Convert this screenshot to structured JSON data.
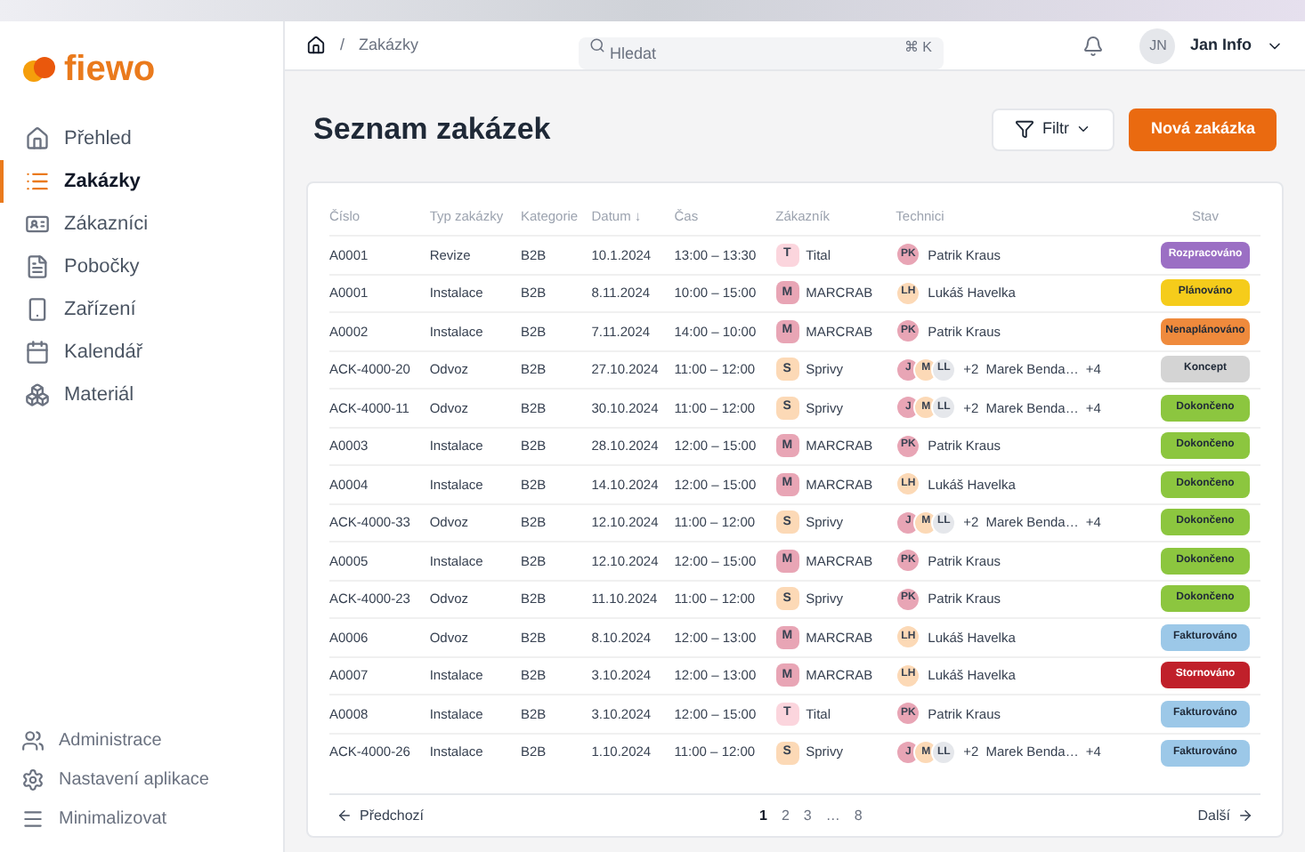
{
  "logo": "fiewo",
  "sidebar": {
    "items": [
      {
        "label": "Přehled",
        "selected": false
      },
      {
        "label": "Zakázky",
        "selected": true
      },
      {
        "label": "Zákazníci",
        "selected": false
      },
      {
        "label": "Pobočky",
        "selected": false
      },
      {
        "label": "Zařízení",
        "selected": false
      },
      {
        "label": "Kalendář",
        "selected": false
      },
      {
        "label": "Materiál",
        "selected": false
      }
    ],
    "bottom_items": [
      {
        "label": "Administrace"
      },
      {
        "label": "Nastavení aplikace"
      },
      {
        "label": "Minimalizovat"
      }
    ]
  },
  "topbar": {
    "breadcrumb_separator": "/",
    "breadcrumb": "Zakázky",
    "search": {
      "placeholder": "Hledat",
      "shortcut": "⌘ K"
    },
    "user": {
      "initials": "JN",
      "name": "Jan Info"
    }
  },
  "page": {
    "title": "Seznam zakázek",
    "filter_button": "Filtr",
    "new_button": "Nová zakázka"
  },
  "table": {
    "columns": [
      "Číslo",
      "Typ zakázky",
      "Kategorie",
      "Datum ↓",
      "Čas",
      "Zákazník",
      "Technici",
      "Stav"
    ],
    "rows": [
      {
        "number": "A0001",
        "type": "Revize",
        "category": "B2B",
        "date": "10.1.2024",
        "time": "13:00 – 13:30",
        "customer": {
          "initial": "T",
          "name": "Tital",
          "color": "#fbd5dd"
        },
        "technicians": {
          "avatars": [
            {
              "initials": "PK",
              "color": "#e8a5b5"
            }
          ],
          "name": "Patrik Kraus"
        },
        "status": {
          "label": "Rozpracováno",
          "color": "#9b6fc4"
        }
      },
      {
        "number": "A0001",
        "type": "Instalace",
        "category": "B2B",
        "date": "8.11.2024",
        "time": "10:00 – 15:00",
        "customer": {
          "initial": "M",
          "name": "MARCRAB",
          "color": "#e8a5b5"
        },
        "technicians": {
          "avatars": [
            {
              "initials": "LH",
              "color": "#fcd9b6"
            }
          ],
          "name": "Lukáš Havelka"
        },
        "status": {
          "label": "Plánováno",
          "color": "#f5cc1b"
        }
      },
      {
        "number": "A0002",
        "type": "Instalace",
        "category": "B2B",
        "date": "7.11.2024",
        "time": "14:00 – 10:00",
        "customer": {
          "initial": "M",
          "name": "MARCRAB",
          "color": "#e8a5b5"
        },
        "technicians": {
          "avatars": [
            {
              "initials": "PK",
              "color": "#e8a5b5"
            }
          ],
          "name": "Patrik Kraus"
        },
        "status": {
          "label": "Nenaplánováno",
          "color": "#ef8a3c"
        }
      },
      {
        "number": "ACK-4000-20",
        "type": "Odvoz",
        "category": "B2B",
        "date": "27.10.2024",
        "time": "11:00 – 12:00",
        "customer": {
          "initial": "S",
          "name": "Sprivy",
          "color": "#fcd9b6"
        },
        "technicians": {
          "avatars": [
            {
              "initials": "J",
              "color": "#e8a5b5"
            },
            {
              "initials": "M",
              "color": "#fcd9b6"
            },
            {
              "initials": "LL",
              "color": "#e5e7eb"
            }
          ],
          "extra": "+2",
          "name": "Marek Benda…",
          "more": "+4"
        },
        "status": {
          "label": "Koncept",
          "color": "#d4d4d4"
        }
      },
      {
        "number": "ACK-4000-11",
        "type": "Odvoz",
        "category": "B2B",
        "date": "30.10.2024",
        "time": "11:00 – 12:00",
        "customer": {
          "initial": "S",
          "name": "Sprivy",
          "color": "#fcd9b6"
        },
        "technicians": {
          "avatars": [
            {
              "initials": "J",
              "color": "#e8a5b5"
            },
            {
              "initials": "M",
              "color": "#fcd9b6"
            },
            {
              "initials": "LL",
              "color": "#e5e7eb"
            }
          ],
          "extra": "+2",
          "name": "Marek Benda…",
          "more": "+4"
        },
        "status": {
          "label": "Dokončeno",
          "color": "#8cc63f"
        }
      },
      {
        "number": "A0003",
        "type": "Instalace",
        "category": "B2B",
        "date": "28.10.2024",
        "time": "12:00 – 15:00",
        "customer": {
          "initial": "M",
          "name": "MARCRAB",
          "color": "#e8a5b5"
        },
        "technicians": {
          "avatars": [
            {
              "initials": "PK",
              "color": "#e8a5b5"
            }
          ],
          "name": "Patrik Kraus"
        },
        "status": {
          "label": "Dokončeno",
          "color": "#8cc63f"
        }
      },
      {
        "number": "A0004",
        "type": "Instalace",
        "category": "B2B",
        "date": "14.10.2024",
        "time": "12:00 – 15:00",
        "customer": {
          "initial": "M",
          "name": "MARCRAB",
          "color": "#e8a5b5"
        },
        "technicians": {
          "avatars": [
            {
              "initials": "LH",
              "color": "#fcd9b6"
            }
          ],
          "name": "Lukáš Havelka"
        },
        "status": {
          "label": "Dokončeno",
          "color": "#8cc63f"
        }
      },
      {
        "number": "ACK-4000-33",
        "type": "Odvoz",
        "category": "B2B",
        "date": "12.10.2024",
        "time": "11:00 – 12:00",
        "customer": {
          "initial": "S",
          "name": "Sprivy",
          "color": "#fcd9b6"
        },
        "technicians": {
          "avatars": [
            {
              "initials": "J",
              "color": "#e8a5b5"
            },
            {
              "initials": "M",
              "color": "#fcd9b6"
            },
            {
              "initials": "LL",
              "color": "#e5e7eb"
            }
          ],
          "extra": "+2",
          "name": "Marek Benda…",
          "more": "+4"
        },
        "status": {
          "label": "Dokončeno",
          "color": "#8cc63f"
        }
      },
      {
        "number": "A0005",
        "type": "Instalace",
        "category": "B2B",
        "date": "12.10.2024",
        "time": "12:00 – 15:00",
        "customer": {
          "initial": "M",
          "name": "MARCRAB",
          "color": "#e8a5b5"
        },
        "technicians": {
          "avatars": [
            {
              "initials": "PK",
              "color": "#e8a5b5"
            }
          ],
          "name": "Patrik Kraus"
        },
        "status": {
          "label": "Dokončeno",
          "color": "#8cc63f"
        }
      },
      {
        "number": "ACK-4000-23",
        "type": "Odvoz",
        "category": "B2B",
        "date": "11.10.2024",
        "time": "11:00 – 12:00",
        "customer": {
          "initial": "S",
          "name": "Sprivy",
          "color": "#fcd9b6"
        },
        "technicians": {
          "avatars": [
            {
              "initials": "PK",
              "color": "#e8a5b5"
            }
          ],
          "name": "Patrik Kraus"
        },
        "status": {
          "label": "Dokončeno",
          "color": "#8cc63f"
        }
      },
      {
        "number": "A0006",
        "type": "Odvoz",
        "category": "B2B",
        "date": "8.10.2024",
        "time": "12:00 – 13:00",
        "customer": {
          "initial": "M",
          "name": "MARCRAB",
          "color": "#e8a5b5"
        },
        "technicians": {
          "avatars": [
            {
              "initials": "LH",
              "color": "#fcd9b6"
            }
          ],
          "name": "Lukáš Havelka"
        },
        "status": {
          "label": "Fakturováno",
          "color": "#9cc8e8"
        }
      },
      {
        "number": "A0007",
        "type": "Instalace",
        "category": "B2B",
        "date": "3.10.2024",
        "time": "12:00 – 13:00",
        "customer": {
          "initial": "M",
          "name": "MARCRAB",
          "color": "#e8a5b5"
        },
        "technicians": {
          "avatars": [
            {
              "initials": "LH",
              "color": "#fcd9b6"
            }
          ],
          "name": "Lukáš Havelka"
        },
        "status": {
          "label": "Stornováno",
          "color": "#c0202a"
        }
      },
      {
        "number": "A0008",
        "type": "Instalace",
        "category": "B2B",
        "date": "3.10.2024",
        "time": "12:00 – 15:00",
        "customer": {
          "initial": "T",
          "name": "Tital",
          "color": "#fbd5dd"
        },
        "technicians": {
          "avatars": [
            {
              "initials": "PK",
              "color": "#e8a5b5"
            }
          ],
          "name": "Patrik Kraus"
        },
        "status": {
          "label": "Fakturováno",
          "color": "#9cc8e8"
        }
      },
      {
        "number": "ACK-4000-26",
        "type": "Instalace",
        "category": "B2B",
        "date": "1.10.2024",
        "time": "11:00 – 12:00",
        "customer": {
          "initial": "S",
          "name": "Sprivy",
          "color": "#fcd9b6"
        },
        "technicians": {
          "avatars": [
            {
              "initials": "J",
              "color": "#e8a5b5"
            },
            {
              "initials": "M",
              "color": "#fcd9b6"
            },
            {
              "initials": "LL",
              "color": "#e5e7eb"
            }
          ],
          "extra": "+2",
          "name": "Marek Benda…",
          "more": "+4"
        },
        "status": {
          "label": "Fakturováno",
          "color": "#9cc8e8"
        }
      }
    ]
  },
  "pagination": {
    "previous": "Předchozí",
    "pages": [
      {
        "label": "1",
        "selected": true
      },
      {
        "label": "2",
        "selected": false
      },
      {
        "label": "3",
        "selected": false
      },
      {
        "label": "…",
        "selected": false
      },
      {
        "label": "8",
        "selected": false
      }
    ],
    "next": "Další"
  }
}
